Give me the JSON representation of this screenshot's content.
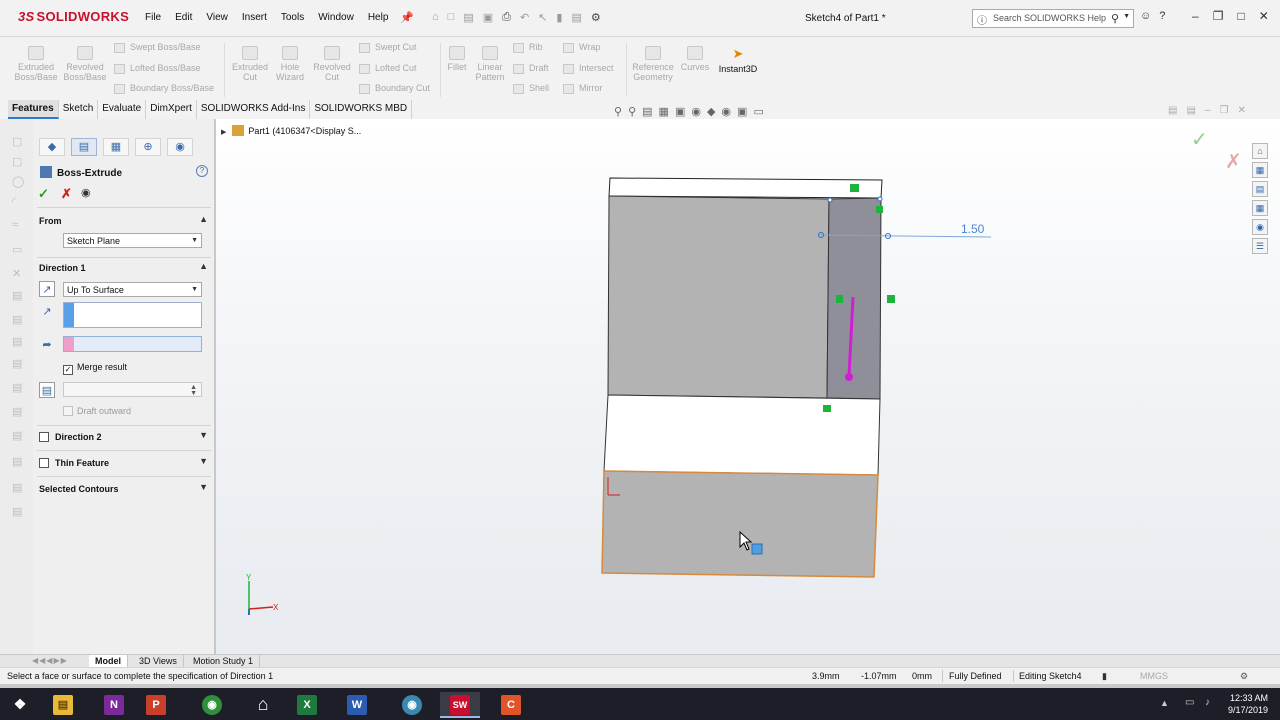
{
  "app": {
    "logo": "SOLIDWORKS",
    "menus": [
      "File",
      "Edit",
      "View",
      "Insert",
      "Tools",
      "Window",
      "Help"
    ],
    "document_title": "Sketch4 of Part1 *",
    "search_placeholder": "Search SOLIDWORKS Help"
  },
  "ribbon": {
    "large": [
      {
        "label": "Extruded Boss/Base",
        "line1": "Extruded",
        "line2": "Boss/Base"
      },
      {
        "label": "Revolved Boss/Base",
        "line1": "Revolved",
        "line2": "Boss/Base"
      },
      {
        "label": "Extruded Cut",
        "line1": "Extruded",
        "line2": "Cut"
      },
      {
        "label": "Hole Wizard",
        "line1": "Hole",
        "line2": "Wizard"
      },
      {
        "label": "Revolved Cut",
        "line1": "Revolved",
        "line2": "Cut"
      },
      {
        "label": "Fillet",
        "line1": "Fillet",
        "line2": ""
      },
      {
        "label": "Linear Pattern",
        "line1": "Linear",
        "line2": "Pattern"
      },
      {
        "label": "Reference Geometry",
        "line1": "Reference",
        "line2": "Geometry"
      },
      {
        "label": "Curves",
        "line1": "Curves",
        "line2": ""
      }
    ],
    "small": {
      "swept_boss": "Swept Boss/Base",
      "lofted_boss": "Lofted Boss/Base",
      "boundary_boss": "Boundary Boss/Base",
      "swept_cut": "Swept Cut",
      "lofted_cut": "Lofted Cut",
      "boundary_cut": "Boundary Cut",
      "rib": "Rib",
      "draft": "Draft",
      "shell": "Shell",
      "wrap": "Wrap",
      "intersect": "Intersect",
      "mirror": "Mirror"
    },
    "instant3d": "Instant3D"
  },
  "tabs": [
    "Features",
    "Sketch",
    "Evaluate",
    "DimXpert",
    "SOLIDWORKS Add-Ins",
    "SOLIDWORKS MBD"
  ],
  "property_manager": {
    "title": "Boss-Extrude",
    "from_label": "From",
    "from_value": "Sketch Plane",
    "direction1_label": "Direction 1",
    "end_condition": "Up To Surface",
    "merge_result": "Merge result",
    "draft_outward": "Draft outward",
    "direction2_label": "Direction 2",
    "thin_feature_label": "Thin Feature",
    "selected_contours_label": "Selected Contours"
  },
  "viewport": {
    "tree_item": "Part1  (4106347<Display S...",
    "dimension": "1.50"
  },
  "bottom_tabs": [
    "Model",
    "3D Views",
    "Motion Study 1"
  ],
  "status": {
    "message": "Select a face or surface to complete the specification of Direction 1",
    "x": "3.9mm",
    "y": "-1.07mm",
    "z": "0mm",
    "state": "Fully Defined",
    "editing": "Editing Sketch4",
    "units": "MMGS"
  },
  "taskbar": {
    "time": "12:33 AM",
    "date": "9/17/2019"
  },
  "colors": {
    "brand": "#c8102e",
    "accent": "#2a7bd0",
    "sketch_magenta": "#d21ed2",
    "relation_green": "#1cb43c"
  }
}
